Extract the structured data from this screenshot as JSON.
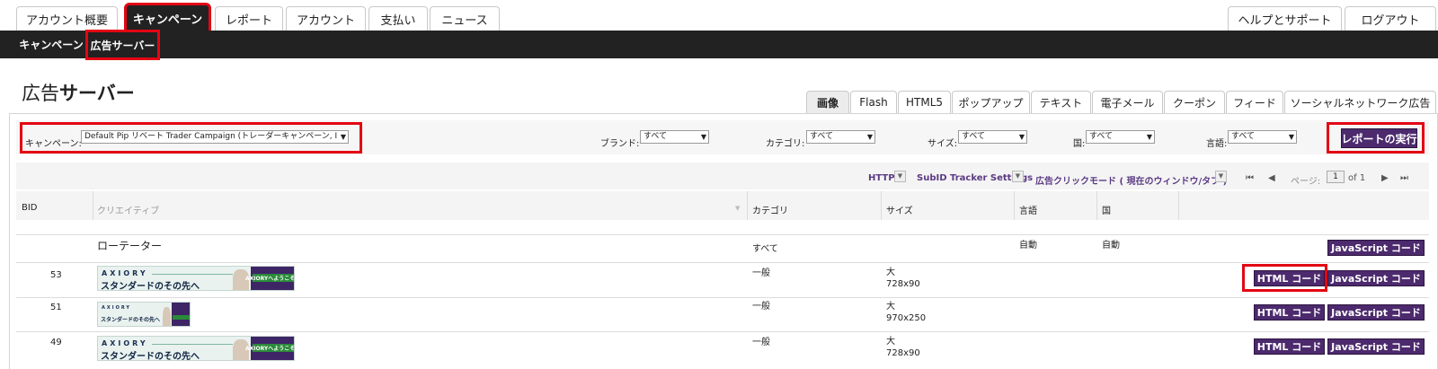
{
  "top_tabs": [
    "アカウント概要",
    "キャンペーン",
    "レポート",
    "アカウント",
    "支払い",
    "ニュース"
  ],
  "top_right_tabs": [
    "ヘルプとサポート",
    "ログアウト"
  ],
  "sub_tabs": [
    "キャンペーン",
    "広告サーバー"
  ],
  "page_title": {
    "prefix": "広告",
    "suffix": "サーバー"
  },
  "ad_type_tabs": [
    "画像",
    "Flash",
    "HTML5",
    "ポップアップ",
    "テキスト",
    "電子メール",
    "クーポン",
    "フィード",
    "ソーシャルネットワーク広告"
  ],
  "filters": {
    "campaign_label": "キャンペーン:",
    "campaign_value": "Default Pip リベート Trader Campaign (トレーダーキャンペーン, I",
    "brand_label": "ブランド:",
    "brand_value": "すべて",
    "category_label": "カテゴリ:",
    "category_value": "すべて",
    "size_label": "サイズ:",
    "size_value": "すべて",
    "country_label": "国:",
    "country_value": "すべて",
    "language_label": "言語:",
    "language_value": "すべて",
    "run_button": "レポートの実行"
  },
  "toolbar": {
    "http": "HTTP",
    "subid": "SubID Tracker Settings",
    "click_mode": "広告クリックモード ( 現在のウィンドウ/タブ )",
    "page_label": "ページ:",
    "page_value": "1",
    "page_of": "of 1"
  },
  "columns": [
    "BID",
    "クリエイティブ",
    "カテゴリ",
    "サイズ",
    "言語",
    "国"
  ],
  "banner": {
    "logo": "AXIORY",
    "tagline": "スタンダードのその先へ",
    "cta": "AXIORYへようこそ ▶"
  },
  "rows": [
    {
      "bid": "",
      "creative": "ローテーター",
      "category": "すべて",
      "size": "",
      "size_dim": "",
      "language": "自動",
      "country": "自動",
      "buttons": [
        "JavaScript コード"
      ]
    },
    {
      "bid": "53",
      "creative": "",
      "category": "一般",
      "size": "大",
      "size_dim": "728x90",
      "language": "",
      "country": "",
      "buttons": [
        "HTML コード",
        "JavaScript コード"
      ]
    },
    {
      "bid": "51",
      "creative": "",
      "category": "一般",
      "size": "大",
      "size_dim": "970x250",
      "language": "",
      "country": "",
      "buttons": [
        "HTML コード",
        "JavaScript コード"
      ]
    },
    {
      "bid": "49",
      "creative": "",
      "category": "一般",
      "size": "大",
      "size_dim": "728x90",
      "language": "",
      "country": "",
      "buttons": [
        "HTML コード",
        "JavaScript コード"
      ]
    }
  ],
  "colors": {
    "accent": "#4c2a6d",
    "dark_bar": "#222222",
    "highlight": "#e30613"
  }
}
